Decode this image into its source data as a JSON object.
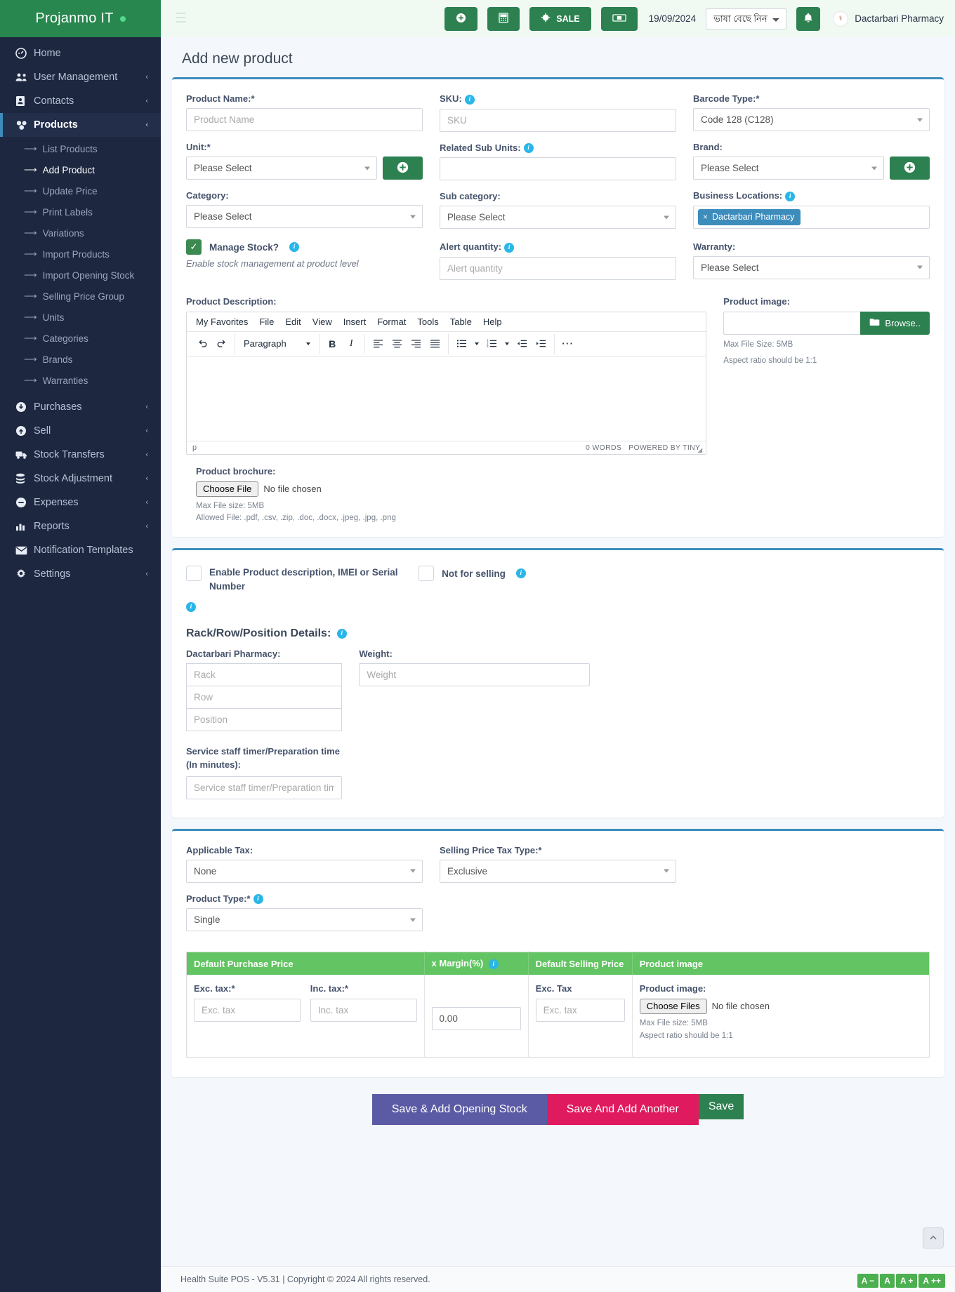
{
  "brand": {
    "name": "Projanmo IT"
  },
  "sidebar": {
    "items": [
      {
        "label": "Home",
        "icon": "dashboard-icon",
        "caret": ""
      },
      {
        "label": "User Management",
        "icon": "users-icon",
        "caret": "‹"
      },
      {
        "label": "Contacts",
        "icon": "contact-card-icon",
        "caret": "‹"
      },
      {
        "label": "Products",
        "icon": "products-icon",
        "caret": "‹"
      }
    ],
    "product_subitems": [
      {
        "label": "List Products",
        "active": false
      },
      {
        "label": "Add Product",
        "active": true
      },
      {
        "label": "Update Price",
        "active": false
      },
      {
        "label": "Print Labels",
        "active": false
      },
      {
        "label": "Variations",
        "active": false
      },
      {
        "label": "Import Products",
        "active": false
      },
      {
        "label": "Import Opening Stock",
        "active": false
      },
      {
        "label": "Selling Price Group",
        "active": false
      },
      {
        "label": "Units",
        "active": false
      },
      {
        "label": "Categories",
        "active": false
      },
      {
        "label": "Brands",
        "active": false
      },
      {
        "label": "Warranties",
        "active": false
      }
    ],
    "items_bottom": [
      {
        "label": "Purchases",
        "icon": "download-circle-icon",
        "caret": "‹"
      },
      {
        "label": "Sell",
        "icon": "upload-circle-icon",
        "caret": "‹"
      },
      {
        "label": "Stock Transfers",
        "icon": "truck-icon",
        "caret": "‹"
      },
      {
        "label": "Stock Adjustment",
        "icon": "stack-icon",
        "caret": "‹"
      },
      {
        "label": "Expenses",
        "icon": "minus-circle-icon",
        "caret": "‹"
      },
      {
        "label": "Reports",
        "icon": "bar-chart-icon",
        "caret": "‹"
      },
      {
        "label": "Notification Templates",
        "icon": "envelope-icon",
        "caret": ""
      },
      {
        "label": "Settings",
        "icon": "gear-icon",
        "caret": "‹"
      }
    ]
  },
  "topbar": {
    "menu_toggle": "hamburger-icon",
    "add_button": "plus-circle-icon",
    "calculator_button": "calculator-icon",
    "sale_button": "SALE",
    "cash_register_button": "cash-register-icon",
    "date": "19/09/2024",
    "language_selected": "ভাষা বেছে নিন",
    "notification_button": "bell-icon",
    "user_name": "Dactarbari Pharmacy"
  },
  "page": {
    "title": "Add new product"
  },
  "form": {
    "product_name": {
      "label": "Product Name:*",
      "placeholder": "Product Name",
      "value": ""
    },
    "sku": {
      "label": "SKU:",
      "placeholder": "SKU",
      "value": ""
    },
    "barcode_type": {
      "label": "Barcode Type:*",
      "value": "Code 128 (C128)"
    },
    "unit": {
      "label": "Unit:*",
      "value": "Please Select"
    },
    "related_sub_units": {
      "label": "Related Sub Units:",
      "placeholder": "",
      "value": ""
    },
    "brand": {
      "label": "Brand:",
      "value": "Please Select"
    },
    "category": {
      "label": "Category:",
      "value": "Please Select"
    },
    "sub_category": {
      "label": "Sub category:",
      "value": "Please Select"
    },
    "business_locations": {
      "label": "Business Locations:",
      "tag": "Dactarbari Pharmacy",
      "remove": "×"
    },
    "manage_stock": {
      "label": "Manage Stock?",
      "checked": true,
      "hint": "Enable stock management at product level",
      "check_glyph": "✓"
    },
    "alert_quantity": {
      "label": "Alert quantity:",
      "placeholder": "Alert quantity",
      "value": ""
    },
    "warranty": {
      "label": "Warranty:",
      "value": "Please Select"
    },
    "product_description": {
      "label": "Product Description:"
    },
    "product_image": {
      "label": "Product image:",
      "browse_label": "Browse..",
      "value": "",
      "meta1": "Max File Size: 5MB",
      "meta2": "Aspect ratio should be 1:1"
    },
    "product_brochure": {
      "label": "Product brochure:",
      "choose_label": "Choose File",
      "no_file": "No file chosen",
      "meta1": "Max File size: 5MB",
      "meta2": "Allowed File: .pdf, .csv, .zip, .doc, .docx, .jpeg, .jpg, .png"
    }
  },
  "editor": {
    "menus": [
      "My Favorites",
      "File",
      "Edit",
      "View",
      "Insert",
      "Format",
      "Tools",
      "Table",
      "Help"
    ],
    "block_format": "Paragraph",
    "bold": "B",
    "italic": "I",
    "more": "⋯",
    "status_path": "p",
    "word_count": "0 WORDS",
    "powered_by": "POWERED BY TINY"
  },
  "section2": {
    "enable_imei": {
      "label": "Enable Product description, IMEI or Serial Number",
      "checked": false
    },
    "not_for_selling": {
      "label": "Not for selling",
      "checked": false
    },
    "rack_heading": "Rack/Row/Position Details:",
    "location_label": "Dactarbari Pharmacy:",
    "rack_placeholder": "Rack",
    "row_placeholder": "Row",
    "position_placeholder": "Position",
    "weight": {
      "label": "Weight:",
      "placeholder": "Weight",
      "value": ""
    },
    "service_timer": {
      "label": "Service staff timer/Preparation time (In minutes):",
      "placeholder": "Service staff timer/Preparation time"
    }
  },
  "section3": {
    "applicable_tax": {
      "label": "Applicable Tax:",
      "value": "None"
    },
    "selling_price_tax_type": {
      "label": "Selling Price Tax Type:*",
      "value": "Exclusive"
    },
    "product_type": {
      "label": "Product Type:*",
      "value": "Single"
    },
    "table": {
      "headers": [
        "Default Purchase Price",
        "x Margin(%)",
        "Default Selling Price",
        "Product image"
      ],
      "exc_tax_label": "Exc. tax:*",
      "exc_tax_placeholder": "Exc. tax",
      "inc_tax_label": "Inc. tax:*",
      "inc_tax_placeholder": "Inc. tax",
      "margin_value": "0.00",
      "selling_exc_label": "Exc. Tax",
      "selling_exc_placeholder": "Exc. tax",
      "product_image_label": "Product image:",
      "choose_files": "Choose Files",
      "no_file": "No file chosen",
      "meta1": "Max File size: 5MB",
      "meta2": "Aspect ratio should be 1:1"
    }
  },
  "actions": {
    "save_opening_stock": "Save & Add Opening Stock",
    "save_add_another": "Save And Add Another",
    "save": "Save"
  },
  "footer": {
    "text": "Health Suite POS - V5.31 | Copyright © 2024 All rights reserved."
  },
  "font_sizer": [
    "A −",
    "A",
    "A +",
    "A ++"
  ],
  "colors": {
    "brand_green": "#27874f",
    "accent_blue": "#3c8dbc",
    "sidebar": "#1d2740",
    "table_header_green": "#62c462",
    "purple": "#5b5ba5",
    "pink": "#e01a5e"
  }
}
